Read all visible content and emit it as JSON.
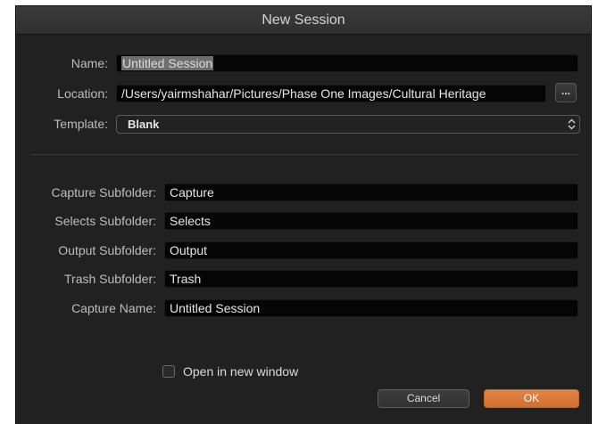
{
  "dialog": {
    "title": "New Session"
  },
  "form": {
    "name_label": "Name:",
    "name_value": "Untitled Session",
    "location_label": "Location:",
    "location_value": "/Users/yairmshahar/Pictures/Phase One Images/Cultural Heritage",
    "browse_label": "...",
    "template_label": "Template:",
    "template_value": "Blank"
  },
  "subfolders": {
    "capture_label": "Capture Subfolder:",
    "capture_value": "Capture",
    "selects_label": "Selects Subfolder:",
    "selects_value": "Selects",
    "output_label": "Output Subfolder:",
    "output_value": "Output",
    "trash_label": "Trash Subfolder:",
    "trash_value": "Trash",
    "capture_name_label": "Capture Name:",
    "capture_name_value": "Untitled Session"
  },
  "options": {
    "open_new_window_label": "Open in new window",
    "open_new_window_checked": false
  },
  "buttons": {
    "cancel_label": "Cancel",
    "ok_label": "OK"
  },
  "colors": {
    "dialog_bg": "#212121",
    "field_bg": "#050505",
    "accent": "#d97a3c",
    "text": "#bdbdbd"
  },
  "icons": {
    "stepper": "up-down-chevron-icon",
    "checkbox": "checkbox-icon"
  }
}
